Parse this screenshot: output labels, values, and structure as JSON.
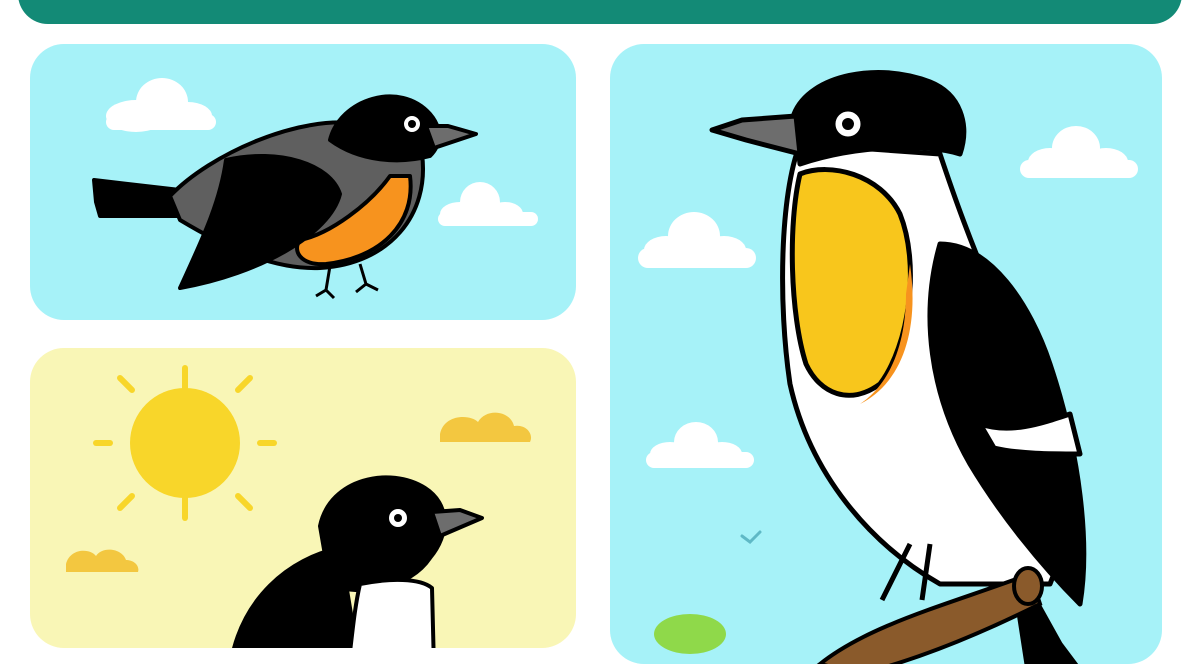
{
  "colors": {
    "banner": "#138a76",
    "sky": "#a6f2f8",
    "sunny_sky": "#f9f6b6",
    "sun": "#f8d62a",
    "cloud": "#ffffff",
    "bird_black": "#000000",
    "bird_gray": "#5f5f5f",
    "breast_orange": "#f7931e",
    "breast_yellow": "#f8c61c",
    "beak_gray": "#6d6d6d",
    "branch": "#8a5a2b",
    "leaf": "#8fd94a"
  },
  "panels": {
    "flying": {
      "subject": "flying-bird"
    },
    "sunny": {
      "subject": "sunny-bird"
    },
    "perched": {
      "subject": "perched-bird"
    }
  }
}
